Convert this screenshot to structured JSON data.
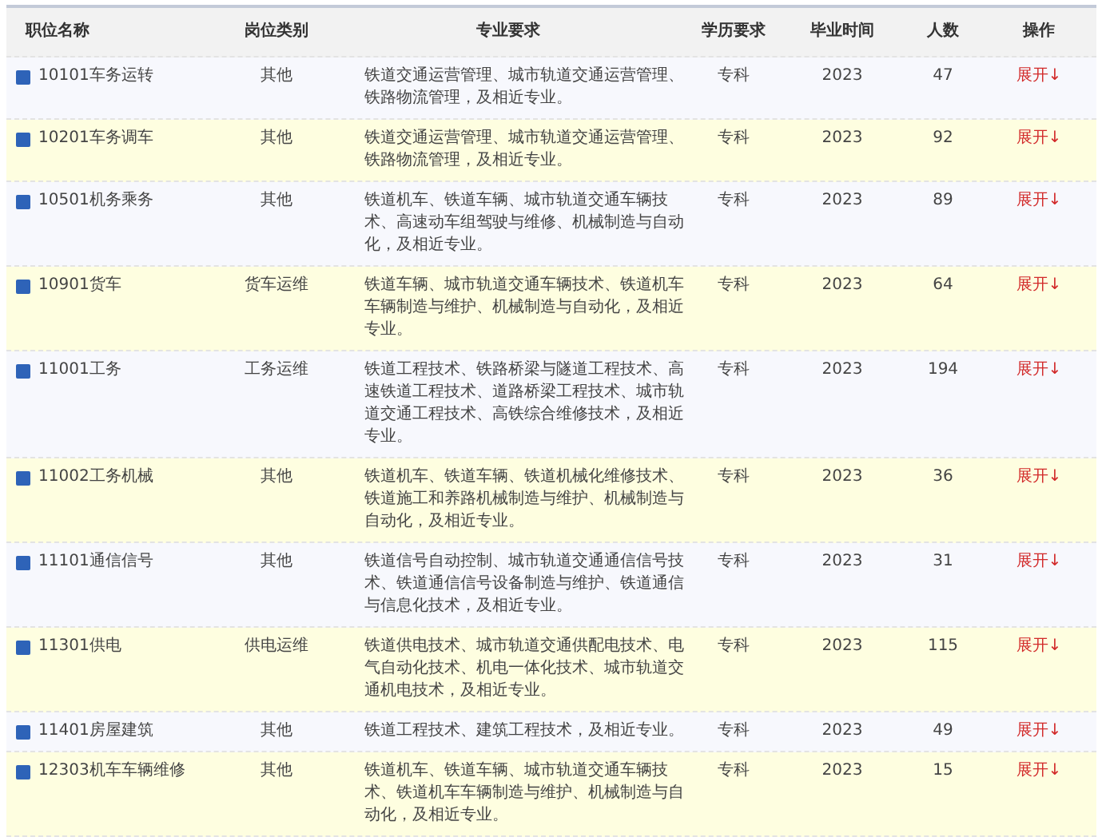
{
  "table": {
    "columns": [
      "职位名称",
      "岗位类别",
      "专业要求",
      "学历要求",
      "毕业时间",
      "人数",
      "操作"
    ],
    "rows": [
      {
        "name": "10101车务运转",
        "category": "其他",
        "major": "铁道交通运营管理、城市轨道交通运营管理、铁路物流管理，及相近专业。",
        "education": "专科",
        "year": "2023",
        "count": "47",
        "action": "展开↓"
      },
      {
        "name": "10201车务调车",
        "category": "其他",
        "major": "铁道交通运营管理、城市轨道交通运营管理、铁路物流管理，及相近专业。",
        "education": "专科",
        "year": "2023",
        "count": "92",
        "action": "展开↓"
      },
      {
        "name": "10501机务乘务",
        "category": "其他",
        "major": "铁道机车、铁道车辆、城市轨道交通车辆技术、高速动车组驾驶与维修、机械制造与自动化，及相近专业。",
        "education": "专科",
        "year": "2023",
        "count": "89",
        "action": "展开↓"
      },
      {
        "name": "10901货车",
        "category": "货车运维",
        "major": "铁道车辆、城市轨道交通车辆技术、铁道机车车辆制造与维护、机械制造与自动化，及相近专业。",
        "education": "专科",
        "year": "2023",
        "count": "64",
        "action": "展开↓"
      },
      {
        "name": "11001工务",
        "category": "工务运维",
        "major": "铁道工程技术、铁路桥梁与隧道工程技术、高速铁道工程技术、道路桥梁工程技术、城市轨道交通工程技术、高铁综合维修技术，及相近专业。",
        "education": "专科",
        "year": "2023",
        "count": "194",
        "action": "展开↓"
      },
      {
        "name": "11002工务机械",
        "category": "其他",
        "major": "铁道机车、铁道车辆、铁道机械化维修技术、铁道施工和养路机械制造与维护、机械制造与自动化，及相近专业。",
        "education": "专科",
        "year": "2023",
        "count": "36",
        "action": "展开↓"
      },
      {
        "name": "11101通信信号",
        "category": "其他",
        "major": "铁道信号自动控制、城市轨道交通通信信号技术、铁道通信信号设备制造与维护、铁道通信与信息化技术，及相近专业。",
        "education": "专科",
        "year": "2023",
        "count": "31",
        "action": "展开↓"
      },
      {
        "name": "11301供电",
        "category": "供电运维",
        "major": "铁道供电技术、城市轨道交通供配电技术、电气自动化技术、机电一体化技术、城市轨道交通机电技术，及相近专业。",
        "education": "专科",
        "year": "2023",
        "count": "115",
        "action": "展开↓"
      },
      {
        "name": "11401房屋建筑",
        "category": "其他",
        "major": "铁道工程技术、建筑工程技术，及相近专业。",
        "education": "专科",
        "year": "2023",
        "count": "49",
        "action": "展开↓"
      },
      {
        "name": "12303机车车辆维修",
        "category": "其他",
        "major": "铁道机车、铁道车辆、城市轨道交通车辆技术、铁道机车车辆制造与维护、机械制造与自动化，及相近专业。",
        "education": "专科",
        "year": "2023",
        "count": "15",
        "action": "展开↓"
      }
    ]
  }
}
